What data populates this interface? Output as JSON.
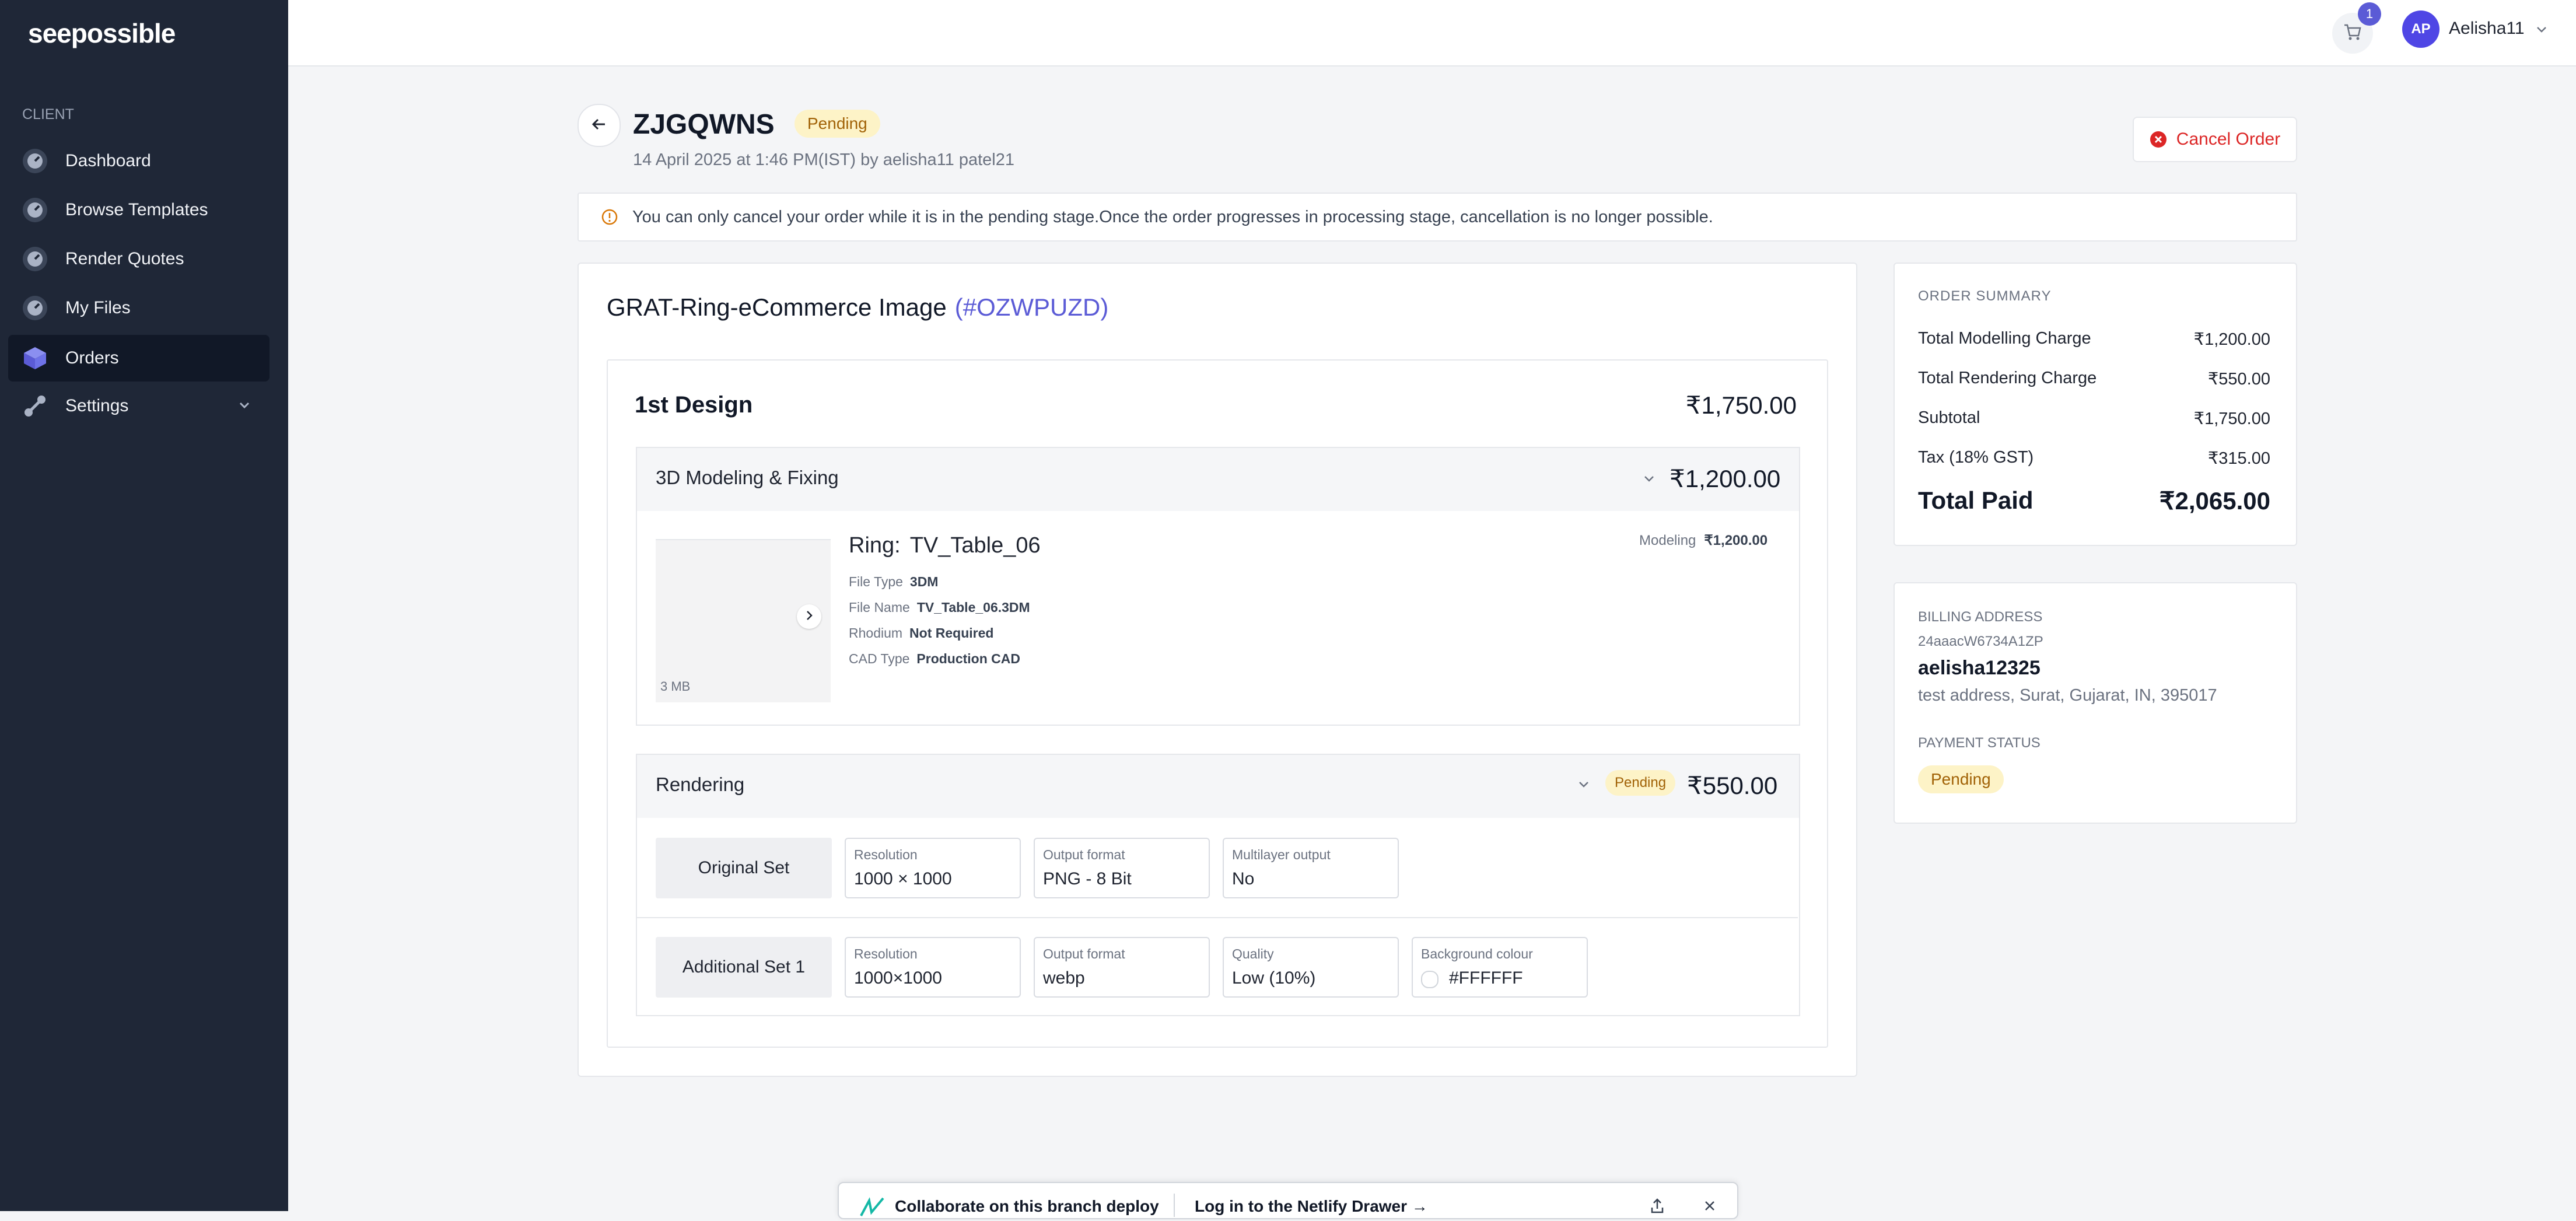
{
  "brand": {
    "logo": "seepossible",
    "accent": "#5b5bd6"
  },
  "sidebar": {
    "section_label": "CLIENT",
    "items": [
      {
        "label": "Dashboard",
        "icon": "dashboard-icon"
      },
      {
        "label": "Browse Templates",
        "icon": "templates-icon"
      },
      {
        "label": "Render Quotes",
        "icon": "quotes-icon"
      },
      {
        "label": "My Files",
        "icon": "files-icon"
      },
      {
        "label": "Orders",
        "icon": "orders-icon",
        "active": true
      },
      {
        "label": "Settings",
        "icon": "settings-icon"
      }
    ]
  },
  "topbar": {
    "cart_count": "1",
    "avatar_initials": "AP",
    "username": "Aelisha11"
  },
  "order": {
    "id": "ZJGQWNS",
    "status": "Pending",
    "meta": "14 April 2025 at 1:46 PM(IST) by aelisha11 patel21",
    "cancel_label": "Cancel Order",
    "notice": "You can only cancel your order while it is in the pending stage.Once the order progresses in processing stage, cancellation is no longer possible."
  },
  "product": {
    "title": "GRAT-Ring-eCommerce Image",
    "ref": "(#OZWPUZD)",
    "design": {
      "title": "1st Design",
      "price": "₹1,750.00",
      "modeling_section": {
        "title": "3D Modeling & Fixing",
        "price": "₹1,200.00",
        "thumb_size": "3 MB",
        "ring_label": "Ring:",
        "ring_name": "TV_Table_06",
        "specs": [
          {
            "label": "File Type",
            "value": "3DM"
          },
          {
            "label": "File Name",
            "value": "TV_Table_06.3DM"
          },
          {
            "label": "Rhodium",
            "value": "Not Required"
          },
          {
            "label": "CAD Type",
            "value": "Production CAD"
          }
        ],
        "modeling_label": "Modeling",
        "modeling_price": "₹1,200.00"
      },
      "rendering_section": {
        "title": "Rendering",
        "status": "Pending",
        "price": "₹550.00",
        "sets": [
          {
            "name": "Original Set",
            "fields": [
              {
                "label": "Resolution",
                "value": "1000 × 1000"
              },
              {
                "label": "Output format",
                "value": "PNG - 8 Bit"
              },
              {
                "label": "Multilayer output",
                "value": "No"
              }
            ]
          },
          {
            "name": "Additional Set 1",
            "fields": [
              {
                "label": "Resolution",
                "value": "1000×1000"
              },
              {
                "label": "Output format",
                "value": "webp"
              },
              {
                "label": "Quality",
                "value": "Low (10%)"
              },
              {
                "label": "Background colour",
                "value": "#FFFFFF"
              }
            ]
          }
        ]
      }
    }
  },
  "summary": {
    "heading": "ORDER SUMMARY",
    "rows": [
      {
        "label": "Total Modelling Charge",
        "value": "₹1,200.00"
      },
      {
        "label": "Total Rendering Charge",
        "value": "₹550.00"
      },
      {
        "label": "Subtotal",
        "value": "₹1,750.00"
      },
      {
        "label": "Tax (18% GST)",
        "value": "₹315.00"
      }
    ],
    "total_label": "Total Paid",
    "total_value": "₹2,065.00"
  },
  "billing": {
    "heading": "BILLING ADDRESS",
    "gst": "24aaacW6734A1ZP",
    "name": "aelisha12325",
    "address": "test address, Surat, Gujarat, IN, 395017",
    "payment_heading": "PAYMENT STATUS",
    "payment_status": "Pending"
  },
  "drawer": {
    "collaborate": "Collaborate on this branch deploy",
    "login": "Log in to the Netlify Drawer →"
  }
}
